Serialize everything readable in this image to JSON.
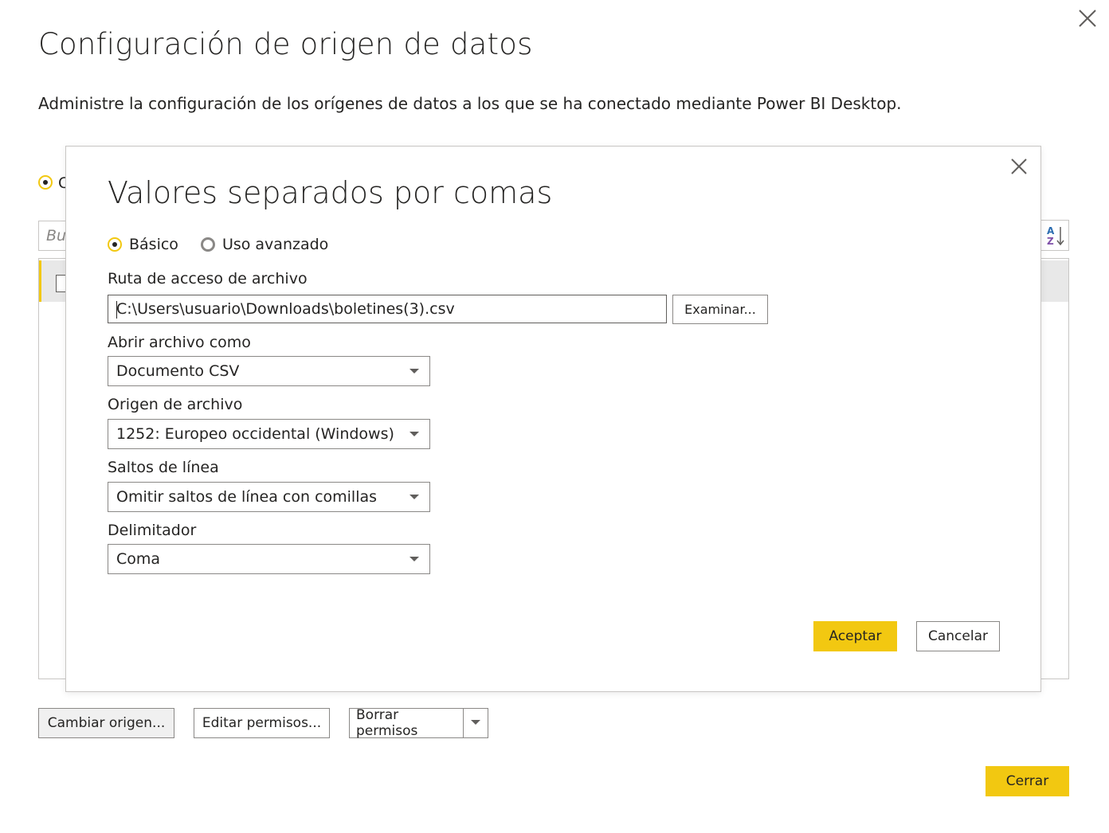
{
  "outer": {
    "title": "Configuración de origen de datos",
    "subtitle": "Administre la configuración de los orígenes de datos a los que se ha conectado mediante Power BI Desktop.",
    "radio_label_partial": "C",
    "search_placeholder_partial": "Bu",
    "buttons": {
      "change_source": "Cambiar origen...",
      "edit_permissions": "Editar permisos...",
      "clear_permissions": "Borrar permisos",
      "close": "Cerrar"
    }
  },
  "modal": {
    "title": "Valores separados por comas",
    "mode": {
      "basic_label": "Básico",
      "advanced_label": "Uso avanzado",
      "selected": "basic"
    },
    "file_path": {
      "label": "Ruta de acceso de archivo",
      "value": "C:\\Users\\usuario\\Downloads\\boletines(3).csv",
      "browse_label": "Examinar..."
    },
    "open_as": {
      "label": "Abrir archivo como",
      "value": "Documento CSV"
    },
    "file_origin": {
      "label": "Origen de archivo",
      "value": "1252: Europeo occidental (Windows)"
    },
    "line_breaks": {
      "label": "Saltos de línea",
      "value": "Omitir saltos de línea con comillas"
    },
    "delimiter": {
      "label": "Delimitador",
      "value": "Coma"
    },
    "buttons": {
      "accept": "Aceptar",
      "cancel": "Cancelar"
    }
  },
  "colors": {
    "accent": "#F2C811",
    "text": "#252423",
    "border": "#8a8886"
  },
  "icons": {
    "close": "close-icon",
    "sort": "sort-az-icon",
    "file": "file-icon",
    "dropdown": "chevron-down-icon"
  }
}
